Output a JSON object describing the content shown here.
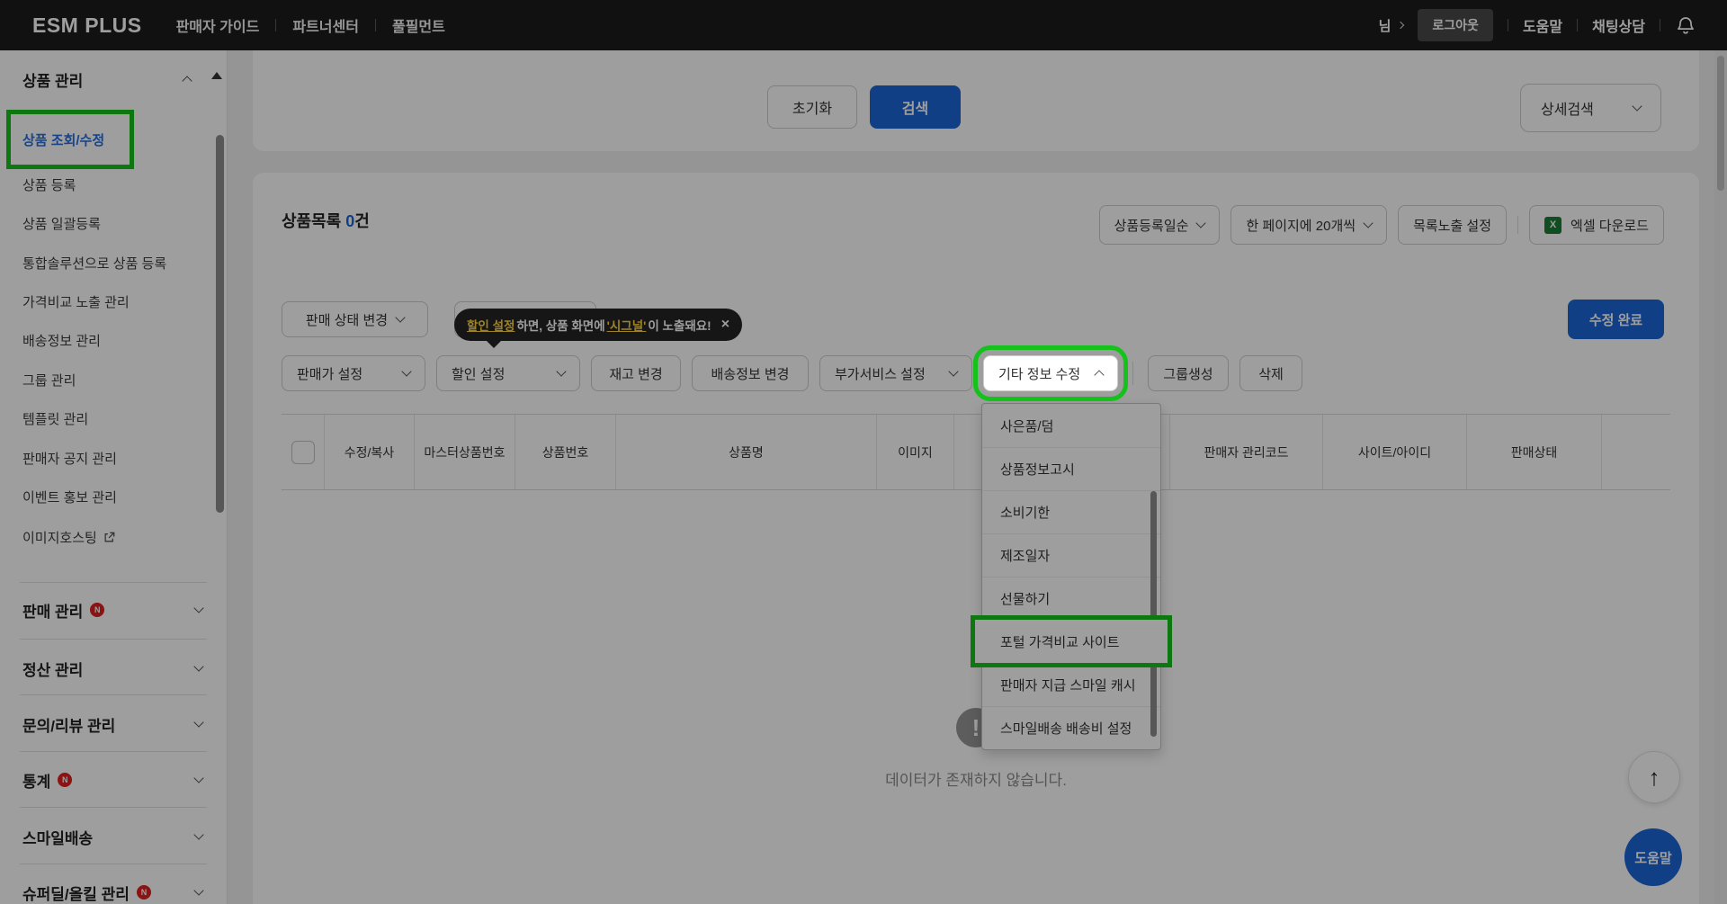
{
  "colors": {
    "accent_blue": "#1b66d9",
    "annotation_green": "#15c21b",
    "badge_red": "#e01f1f",
    "excel_green": "#1a7f37",
    "tooltip_yellow": "#ffd43b",
    "header_bg": "#1c1c1c"
  },
  "header": {
    "logo": "ESM PLUS",
    "nav": [
      "판매자 가이드",
      "파트너센터",
      "풀필먼트"
    ],
    "user": "님",
    "logout": "로그아웃",
    "help": "도움말",
    "chat": "채팅상담"
  },
  "sidebar": {
    "group_title": "상품 관리",
    "items": [
      "상품 조회/수정",
      "상품 등록",
      "상품 일괄등록",
      "통합솔루션으로 상품 등록",
      "가격비교 노출 관리",
      "배송정보 관리",
      "그룹 관리",
      "템플릿 관리",
      "판매자 공지 관리",
      "이벤트 홍보 관리",
      "이미지호스팅"
    ],
    "sections": [
      {
        "label": "판매 관리",
        "badge": "N"
      },
      {
        "label": "정산 관리",
        "badge": ""
      },
      {
        "label": "문의/리뷰 관리",
        "badge": ""
      },
      {
        "label": "통계",
        "badge": "N"
      },
      {
        "label": "스마일배송",
        "badge": ""
      },
      {
        "label": "슈퍼딜/올킬 관리",
        "badge": "N"
      }
    ]
  },
  "search_panel": {
    "reset": "초기화",
    "search": "검색",
    "detail": "상세검색"
  },
  "list": {
    "title": "상품목록",
    "count": "0",
    "count_unit": "건",
    "sort": "상품등록일순",
    "page_size": "한 페이지에 20개씩",
    "columns_btn": "목록노출 설정",
    "excel_icon": "X",
    "excel": "엑셀 다운로드",
    "sale_status_btn": "판매 상태 변경",
    "tooltip": {
      "link": "할인 설정",
      "mid": "하면, 상품 화면에 ",
      "signal": "'시그널'",
      "tail": "이 노출돼요!",
      "close": "×"
    },
    "edit_done": "수정 완료",
    "tools": [
      "판매가 설정",
      "할인 설정",
      "재고 변경",
      "배송정보 변경",
      "부가서비스 설정",
      "기타 정보 수정",
      "그룹생성",
      "삭제"
    ],
    "menu": [
      "사은품/덤",
      "상품정보고시",
      "소비기한",
      "제조일자",
      "선물하기",
      "포털 가격비교 사이트",
      "판매자 지급 스마일 캐시",
      "스마일배송 배송비 설정"
    ],
    "table_headers": [
      "수정/복사",
      "마스터상품번호",
      "상품번호",
      "상품명",
      "이미지",
      "판매자 관리코드",
      "사이트/아이디",
      "판매상태"
    ],
    "empty_icon": "!",
    "empty": "데이터가 존재하지 않습니다."
  },
  "floating": {
    "scroll_top": "↑",
    "help": "도움말"
  }
}
